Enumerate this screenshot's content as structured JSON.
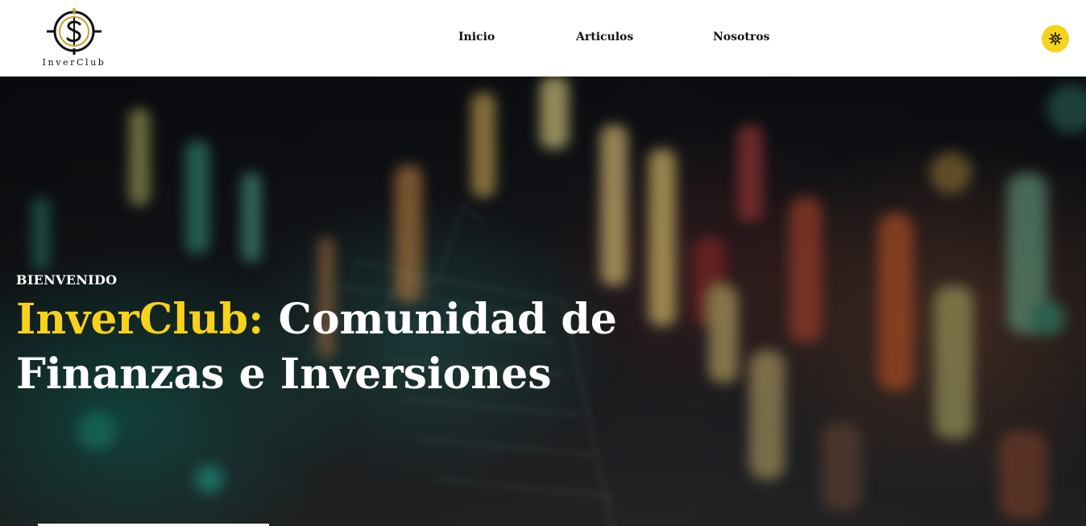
{
  "header": {
    "logo": {
      "text": "InverClub",
      "icon": "dollar-coin-target-icon",
      "accent_color": "#c9a227"
    },
    "nav": [
      {
        "label": "Inicio"
      },
      {
        "label": "Articulos"
      },
      {
        "label": "Nosotros"
      }
    ],
    "theme_toggle": {
      "icon": "sun-icon",
      "color": "#f7d21b"
    }
  },
  "hero": {
    "kicker": "BIENVENIDO",
    "title_brand": "InverClub:",
    "title_rest": "Comunidad de Finanzas e Inversiones",
    "brand_color": "#f7d21b",
    "background": "blurred stock market candlestick chart"
  }
}
